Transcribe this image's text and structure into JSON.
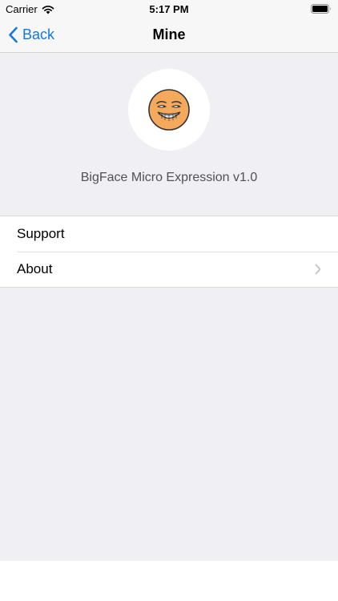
{
  "status_bar": {
    "carrier": "Carrier",
    "time": "5:17 PM",
    "icons": [
      "wifi-icon",
      "battery-icon"
    ]
  },
  "nav": {
    "back_label": "Back",
    "title": "Mine",
    "accent_color": "#1577e6"
  },
  "profile": {
    "avatar_icon": "grinning-face-icon",
    "app_version": "BigFace Micro Expression v1.0"
  },
  "menu": {
    "items": [
      {
        "label": "Support",
        "has_chevron": false
      },
      {
        "label": "About",
        "has_chevron": true,
        "icon": "chevron-right-icon"
      }
    ]
  },
  "colors": {
    "background": "#efeff4",
    "face": "#f5a95c"
  }
}
